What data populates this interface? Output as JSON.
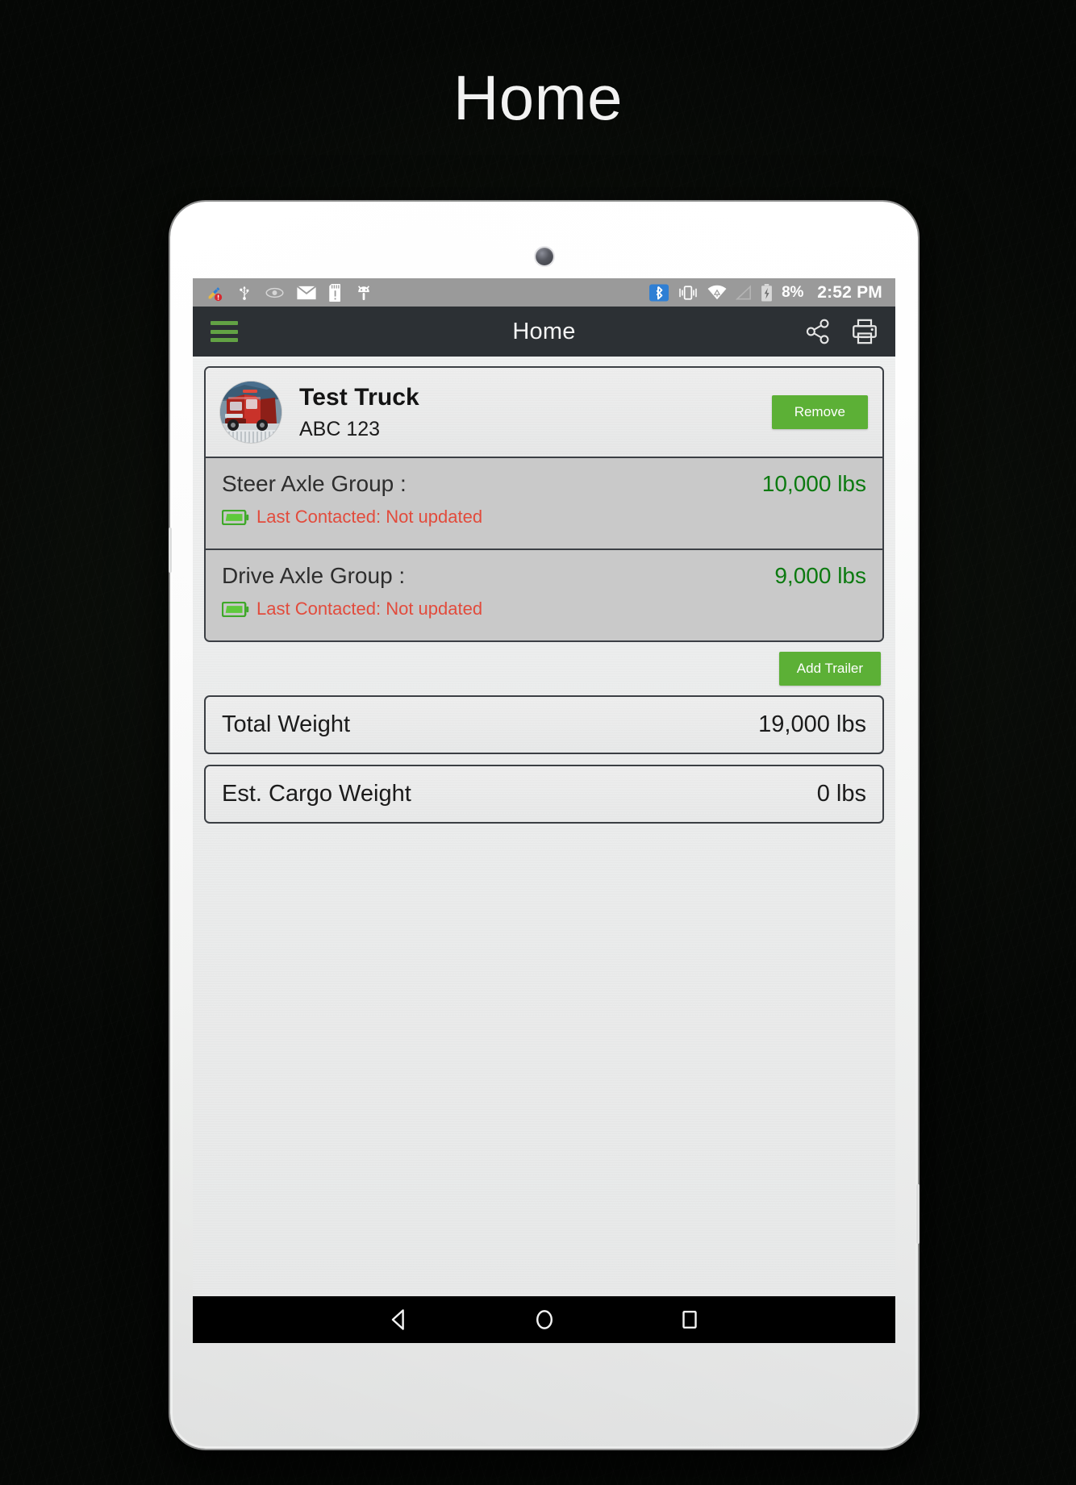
{
  "page": {
    "heading": "Home",
    "background_color": "#0a0d09"
  },
  "device": {
    "type": "white-tablet",
    "camera": "front-camera"
  },
  "status_bar": {
    "background_color": "#9a9a9a",
    "left_icons": [
      {
        "name": "cleaner-alert-icon",
        "label": "Cleaner alert"
      },
      {
        "name": "usb-icon",
        "label": "USB connected"
      },
      {
        "name": "eye-icon",
        "label": "Smart stay"
      },
      {
        "name": "email-icon",
        "label": "New email"
      },
      {
        "name": "sd-card-icon",
        "label": "SD card"
      },
      {
        "name": "android-debug-icon",
        "label": "Android debug"
      }
    ],
    "right_icons": [
      {
        "name": "bluetooth-icon",
        "label": "Bluetooth on",
        "color": "#2f7fd4"
      },
      {
        "name": "vibrate-icon",
        "label": "Vibrate mode"
      },
      {
        "name": "wifi-icon",
        "label": "Wi-Fi connected"
      },
      {
        "name": "signal-icon",
        "label": "No signal"
      },
      {
        "name": "battery-charging-icon",
        "label": "Battery charging"
      }
    ],
    "battery_percent": "8%",
    "clock": "2:52 PM"
  },
  "app_bar": {
    "background_color": "#2c3034",
    "menu_icon": "hamburger-menu-icon",
    "menu_color": "#62a244",
    "title": "Home",
    "actions": [
      {
        "name": "share-icon",
        "label": "Share"
      },
      {
        "name": "print-icon",
        "label": "Print"
      }
    ]
  },
  "vehicle": {
    "avatar": "truck-photo-avatar",
    "name": "Test Truck",
    "plate": "ABC 123",
    "remove_label": "Remove",
    "accent_color": "#5cb036",
    "axle_groups": [
      {
        "label": "Steer Axle Group :",
        "weight": "10,000 lbs",
        "weight_color": "#0c7a10",
        "battery_icon": "battery-full-icon",
        "status_text": "Last Contacted: Not updated",
        "status_color": "#e24b3c"
      },
      {
        "label": "Drive Axle Group :",
        "weight": "9,000 lbs",
        "weight_color": "#0c7a10",
        "battery_icon": "battery-full-icon",
        "status_text": "Last Contacted: Not updated",
        "status_color": "#e24b3c"
      }
    ]
  },
  "add_trailer": {
    "label": "Add Trailer"
  },
  "summary": [
    {
      "label": "Total Weight",
      "value": "19,000 lbs"
    },
    {
      "label": "Est. Cargo Weight",
      "value": "0 lbs"
    }
  ],
  "nav_bar": {
    "background_color": "#000000",
    "buttons": [
      {
        "name": "back-button",
        "label": "Back"
      },
      {
        "name": "home-button",
        "label": "Home"
      },
      {
        "name": "recents-button",
        "label": "Recent apps"
      }
    ]
  }
}
